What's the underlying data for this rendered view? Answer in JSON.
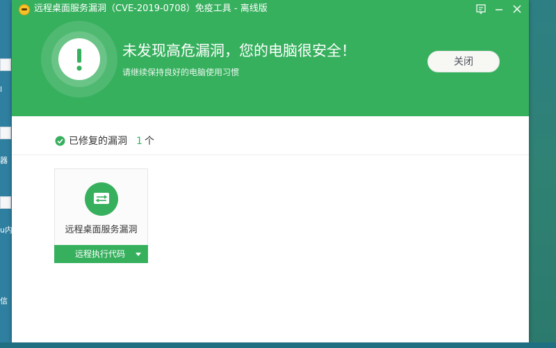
{
  "window": {
    "title": "远程桌面服务漏洞（CVE-2019-0708）免疫工具 - 离线版"
  },
  "hero": {
    "headline": "未发现高危漏洞，您的电脑很安全！",
    "subline": "请继续保持良好的电脑使用习惯",
    "close_label": "关闭",
    "status_icon": "exclamation-icon"
  },
  "summary": {
    "fixed_label": "已修复的漏洞",
    "fixed_count": "1",
    "unit": "个"
  },
  "vulnerabilities": [
    {
      "title": "远程桌面服务漏洞",
      "tag": "远程执行代码",
      "icon": "remote-desktop-icon"
    }
  ],
  "desktop": {
    "labels": [
      "l",
      "器",
      "u内",
      "信"
    ]
  },
  "colors": {
    "brand_green": "#37b05e",
    "desktop_bg": "#277d97"
  }
}
